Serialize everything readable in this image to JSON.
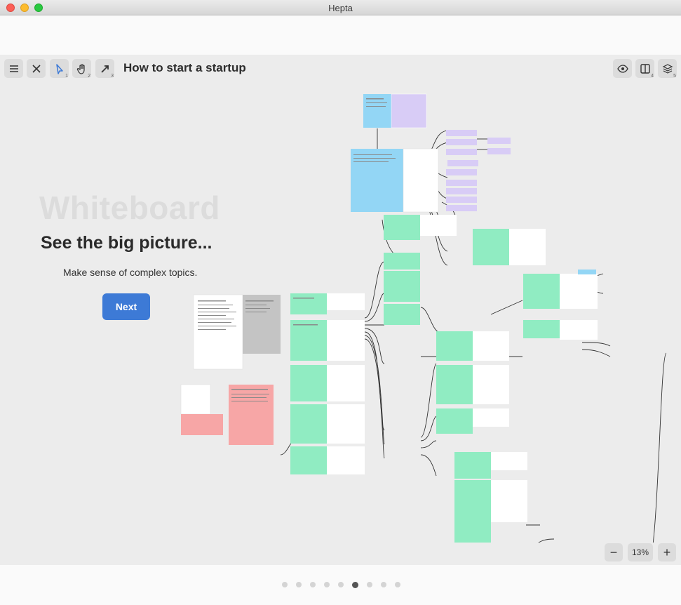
{
  "window": {
    "title": "Hepta"
  },
  "toolbar": {
    "menu_icon": "menu-icon",
    "close_icon": "close-icon",
    "select_tool": {
      "icon": "cursor-arrow-icon",
      "shortcut": "1"
    },
    "hand_tool": {
      "icon": "hand-icon",
      "shortcut": "2"
    },
    "arrow_tool": {
      "icon": "arrow-icon",
      "shortcut": "3"
    },
    "document_title": "How to start a startup",
    "preview_icon": "eye-icon",
    "layout_tool": {
      "icon": "split-panel-icon",
      "shortcut": "4"
    },
    "layers_tool": {
      "icon": "layers-icon",
      "shortcut": "5"
    }
  },
  "onboarding": {
    "heading": "Whiteboard",
    "subheading": "See the big picture...",
    "description": "Make sense of complex topics.",
    "next_label": "Next"
  },
  "zoom": {
    "minus": "−",
    "level": "13%",
    "plus": "+"
  },
  "pagination": {
    "total": 9,
    "current_index": 5
  },
  "colors": {
    "accent": "#3d7ad6",
    "card_green": "#90ecc2",
    "card_blue": "#93d6f5",
    "card_purple": "#d8ccf6",
    "card_red": "#f7a6a6",
    "card_gray": "#c4c4c4"
  }
}
